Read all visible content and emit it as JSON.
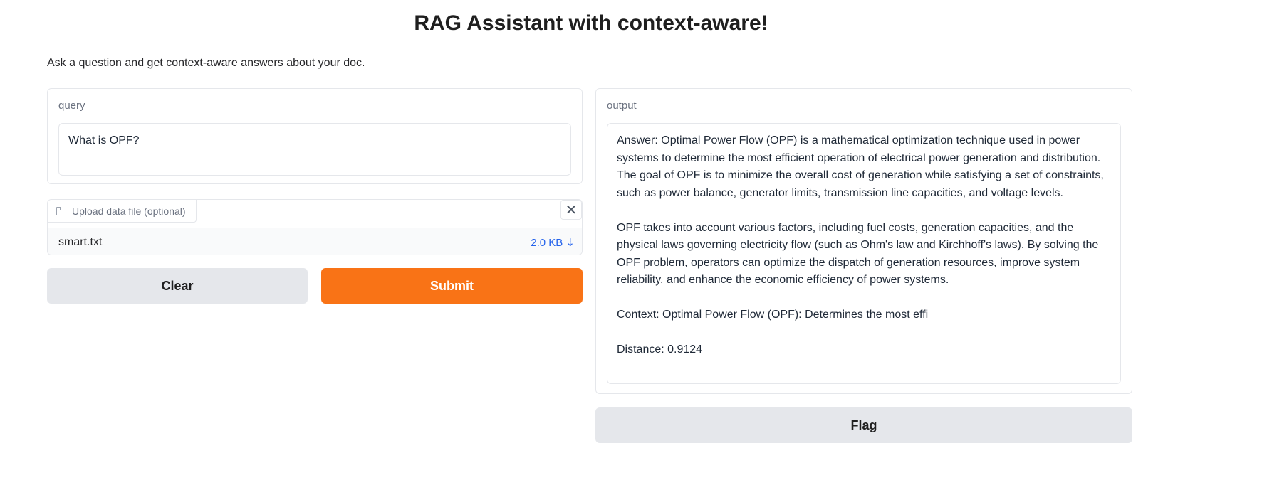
{
  "header": {
    "title": "RAG Assistant with context-aware!",
    "description": "Ask a question and get context-aware answers about your doc."
  },
  "query": {
    "label": "query",
    "value": "What is OPF?"
  },
  "upload": {
    "label": "Upload data file (optional)",
    "file_name": "smart.txt",
    "file_size": "2.0 KB ⇣",
    "close_glyph": "✕"
  },
  "buttons": {
    "clear": "Clear",
    "submit": "Submit",
    "flag": "Flag"
  },
  "output": {
    "label": "output",
    "paragraphs": [
      "Answer: Optimal Power Flow (OPF) is a mathematical optimization technique used in power systems to determine the most efficient operation of electrical power generation and distribution. The goal of OPF is to minimize the overall cost of generation while satisfying a set of constraints, such as power balance, generator limits, transmission line capacities, and voltage levels.",
      "OPF takes into account various factors, including fuel costs, generation capacities, and the physical laws governing electricity flow (such as Ohm's law and Kirchhoff's laws). By solving the OPF problem, operators can optimize the dispatch of generation resources, improve system reliability, and enhance the economic efficiency of power systems.",
      "Context: Optimal Power Flow (OPF): Determines the most effi",
      "Distance: 0.9124"
    ]
  },
  "colors": {
    "accent": "#f97316",
    "secondary_button": "#e5e7eb",
    "link": "#2563eb"
  }
}
